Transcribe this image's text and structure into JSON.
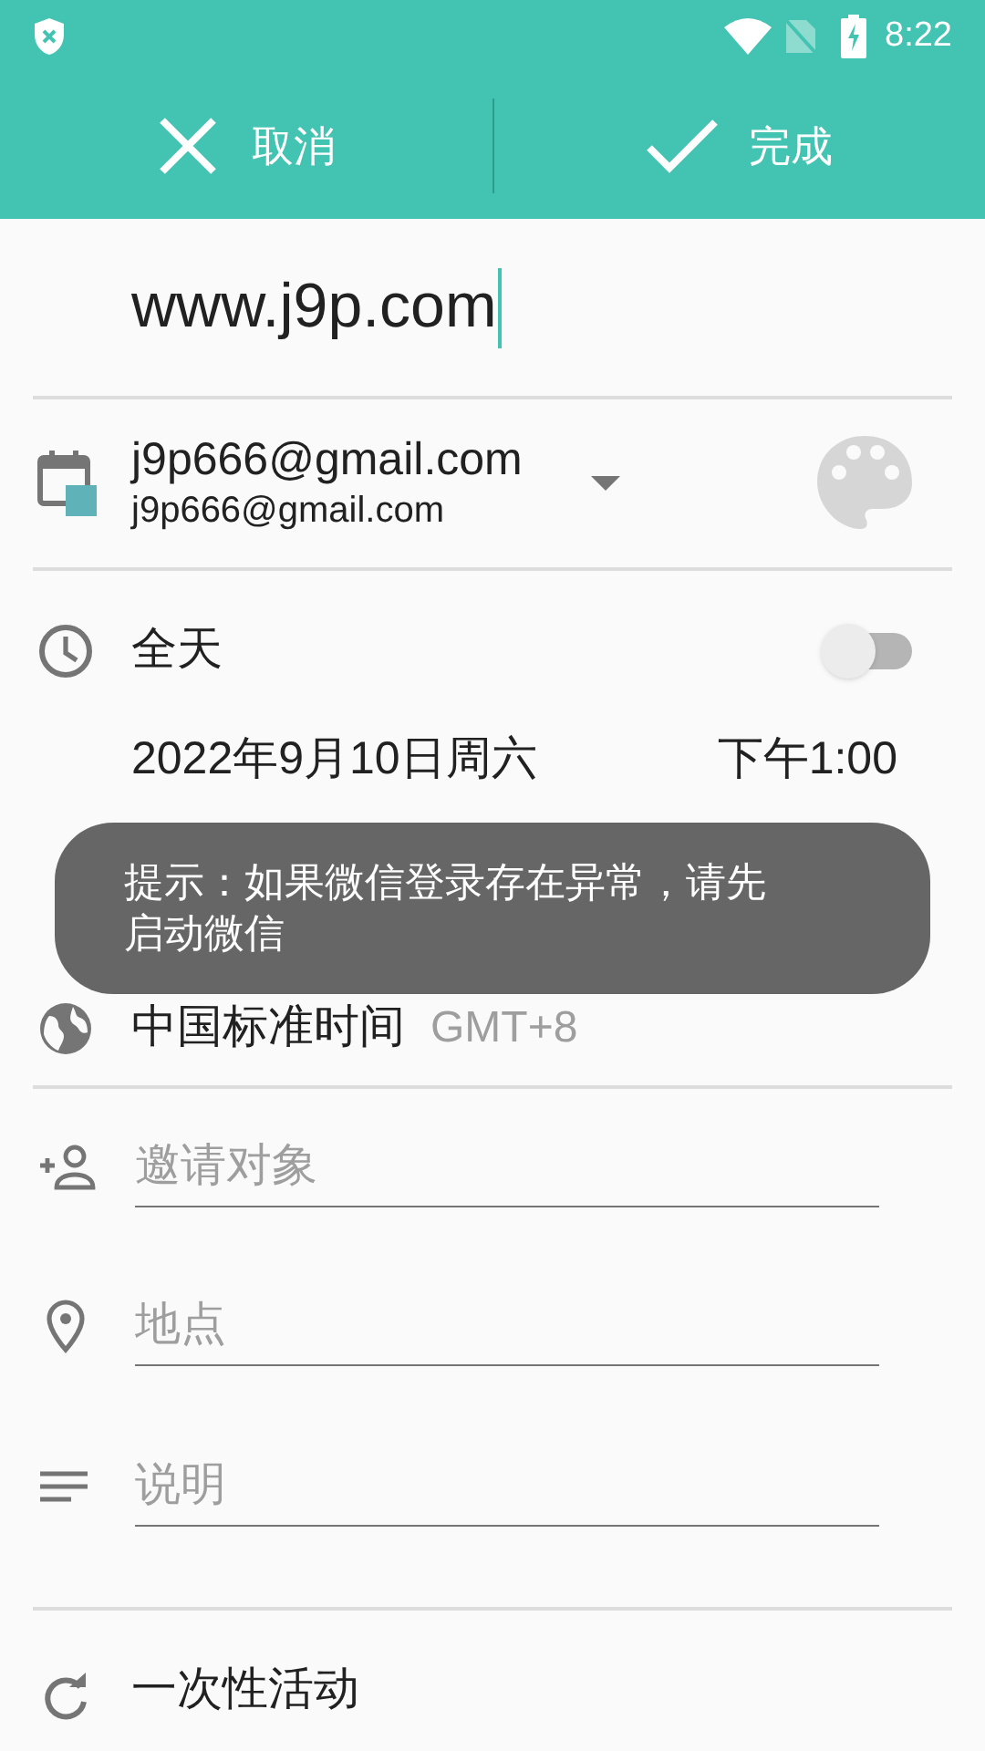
{
  "status_bar": {
    "time": "8:22"
  },
  "action_bar": {
    "cancel": "取消",
    "done": "完成"
  },
  "title_field": {
    "value": "www.j9p.com"
  },
  "calendar": {
    "name": "j9p666@gmail.com",
    "account": "j9p666@gmail.com",
    "color": "#5fb3b8"
  },
  "all_day": {
    "label": "全天",
    "on": false
  },
  "start": {
    "date": "2022年9月10日周六",
    "time": "下午1:00"
  },
  "timezone": {
    "name": "中国标准时间",
    "offset": "GMT+8"
  },
  "fields": [
    {
      "kind": "guests",
      "placeholder": "邀请对象"
    },
    {
      "kind": "location",
      "placeholder": "地点"
    },
    {
      "kind": "description",
      "placeholder": "说明"
    }
  ],
  "repeat": {
    "label": "一次性活动"
  },
  "toast": {
    "text": "提示：如果微信登录存在异常，请先启动微信"
  }
}
